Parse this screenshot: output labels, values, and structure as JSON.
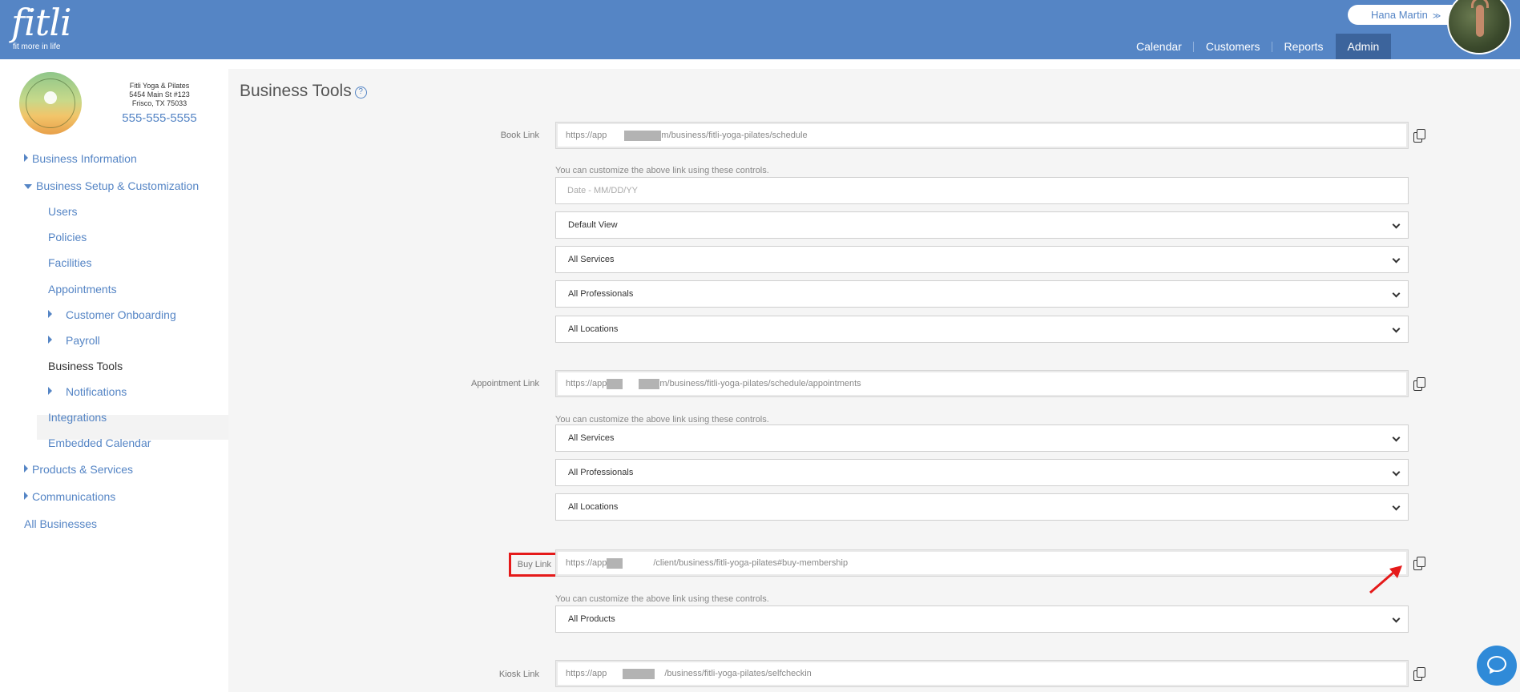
{
  "header": {
    "logo_text": "fitli",
    "logo_tagline": "fit more in life",
    "user_name": "Hana Martin",
    "nav": [
      {
        "label": "Calendar"
      },
      {
        "label": "Customers"
      },
      {
        "label": "Reports"
      },
      {
        "label": "Admin",
        "active": true
      }
    ]
  },
  "business": {
    "name": "Fitli Yoga & Pilates",
    "address1": "5454 Main St #123",
    "address2": "Frisco, TX 75033",
    "phone": "555-555-5555"
  },
  "sidebar": {
    "items": [
      {
        "label": "Business Information"
      },
      {
        "label": "Business Setup & Customization"
      },
      {
        "label": "Users"
      },
      {
        "label": "Policies"
      },
      {
        "label": "Facilities"
      },
      {
        "label": "Appointments"
      },
      {
        "label": "Customer Onboarding"
      },
      {
        "label": "Payroll"
      },
      {
        "label": "Business Tools"
      },
      {
        "label": "Notifications"
      },
      {
        "label": "Integrations"
      },
      {
        "label": "Embedded Calendar"
      },
      {
        "label": "Products & Services"
      },
      {
        "label": "Communications"
      },
      {
        "label": "All Businesses"
      }
    ]
  },
  "main": {
    "title": "Business Tools",
    "help_icon_text": "?",
    "hint_text": "You can customize the above link using these controls.",
    "book": {
      "label": "Book Link",
      "url_prefix": "https://app",
      "url_suffix": "m/business/fitli-yoga-pilates/schedule",
      "date_placeholder": "Date - MM/DD/YY",
      "selects": [
        "Default View",
        "All Services",
        "All Professionals",
        "All Locations"
      ]
    },
    "appointment": {
      "label": "Appointment Link",
      "url_prefix": "https://app",
      "url_suffix": "m/business/fitli-yoga-pilates/schedule/appointments",
      "selects": [
        "All Services",
        "All Professionals",
        "All Locations"
      ]
    },
    "buy": {
      "label": "Buy Link",
      "url_prefix": "https://app",
      "url_suffix": "/client/business/fitli-yoga-pilates#buy-membership",
      "selects": [
        "All Products"
      ]
    },
    "kiosk": {
      "label": "Kiosk Link",
      "url_prefix": "https://app",
      "url_suffix": "/business/fitli-yoga-pilates/selfcheckin"
    }
  },
  "colors": {
    "header_bg": "#5585c5",
    "nav_active_bg": "#3c649c",
    "link": "#5585c5",
    "highlight": "#e51a1a",
    "chat": "#2f8ad8"
  }
}
